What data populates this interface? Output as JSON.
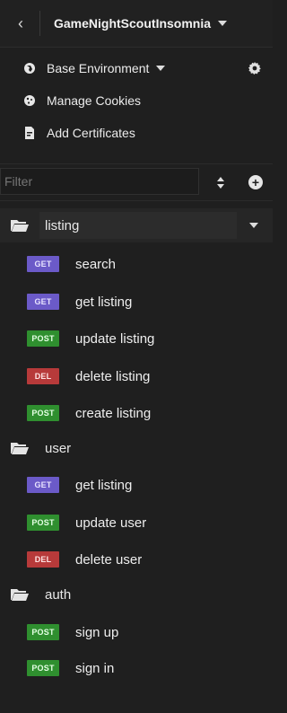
{
  "header": {
    "workspace_title": "GameNightScoutInsomnia"
  },
  "menu": {
    "environment": "Base Environment",
    "cookies": "Manage Cookies",
    "certificates": "Add Certificates"
  },
  "filter": {
    "placeholder": "Filter"
  },
  "colors": {
    "get": "#6b5ac8",
    "post": "#2f8f2f",
    "del": "#b73a3a",
    "folder": "#e4e4e4"
  },
  "tree": {
    "folders": [
      {
        "name": "listing",
        "requests": [
          {
            "method": "GET",
            "name": "search"
          },
          {
            "method": "GET",
            "name": "get listing"
          },
          {
            "method": "POST",
            "name": "update listing"
          },
          {
            "method": "DEL",
            "name": "delete listing"
          },
          {
            "method": "POST",
            "name": "create listing"
          }
        ]
      },
      {
        "name": "user",
        "requests": [
          {
            "method": "GET",
            "name": "get listing"
          },
          {
            "method": "POST",
            "name": "update user"
          },
          {
            "method": "DEL",
            "name": "delete user"
          }
        ]
      },
      {
        "name": "auth",
        "requests": [
          {
            "method": "POST",
            "name": "sign up"
          },
          {
            "method": "POST",
            "name": "sign in"
          }
        ]
      }
    ]
  }
}
